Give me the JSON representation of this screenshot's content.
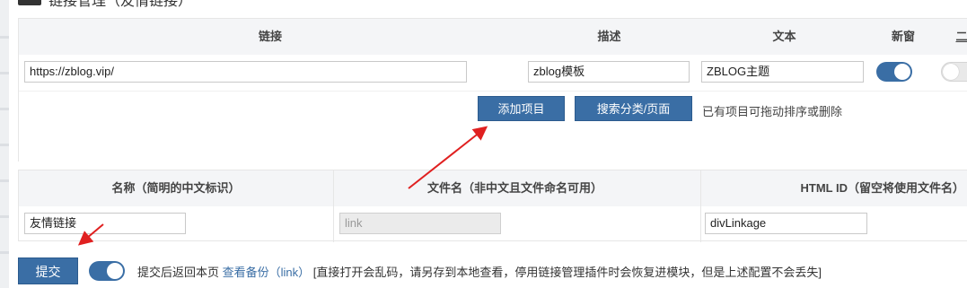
{
  "header": {
    "title": "链接管理（友情链接）"
  },
  "links_table": {
    "columns": {
      "link": "链接",
      "desc": "描述",
      "text": "文本",
      "new_window": "新窗",
      "extra": "二"
    },
    "row": {
      "link": "https://zblog.vip/",
      "desc": "zblog模板",
      "text": "ZBLOG主题",
      "new_window_on": true,
      "extra_on": false
    },
    "actions": {
      "add_item": "添加项目",
      "search": "搜索分类/页面",
      "hint": "已有项目可拖动排序或删除"
    }
  },
  "config_table": {
    "columns": {
      "name": "名称（简明的中文标识）",
      "filename": "文件名（非中文且文件命名可用）",
      "html_id": "HTML ID（留空将使用文件名）"
    },
    "values": {
      "name": "友情链接",
      "filename": "link",
      "html_id": "divLinkage"
    }
  },
  "footer": {
    "submit": "提交",
    "return_toggle_on": true,
    "text_before": "提交后返回本页",
    "backup_link": "查看备份（link）",
    "text_after": "[直接打开会乱码，请另存到本地查看，停用链接管理插件时会恢复进模块，但是上述配置不会丢失]"
  },
  "colors": {
    "accent": "#3a6ea5",
    "annotation": "#e02020",
    "header_bg": "#f4f5f7"
  }
}
